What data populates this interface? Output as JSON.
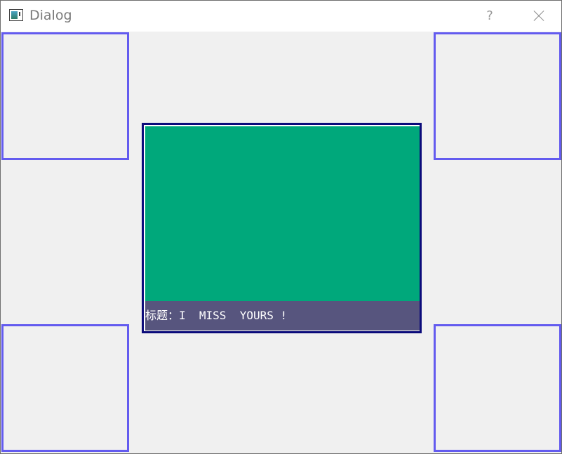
{
  "window": {
    "title": "Dialog",
    "help_label": "?"
  },
  "card": {
    "caption": "标题：I  MISS  YOURS !",
    "image_color": "#00a87b",
    "caption_bg": "#57557e"
  },
  "colors": {
    "frame_border": "#635bef",
    "card_border": "#0b0b7a",
    "background": "#f0f0f0"
  }
}
